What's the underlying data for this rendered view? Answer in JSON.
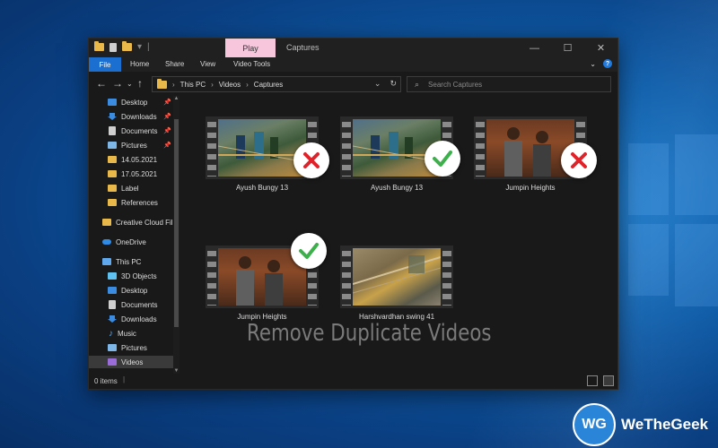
{
  "window": {
    "title": "Captures",
    "context_tab": "Play",
    "controls": [
      "—",
      "☐",
      "✕"
    ]
  },
  "ribbon": {
    "file": "File",
    "tabs": [
      "Home",
      "Share",
      "View",
      "Video Tools"
    ]
  },
  "address": {
    "root": "This PC",
    "crumbs": [
      "This PC",
      "Videos",
      "Captures"
    ],
    "search_placeholder": "Search Captures"
  },
  "nav": {
    "quick_access": [
      {
        "label": "Desktop",
        "icon": "desktop-icon",
        "pinned": true
      },
      {
        "label": "Downloads",
        "icon": "download-icon",
        "pinned": true
      },
      {
        "label": "Documents",
        "icon": "documents-icon",
        "pinned": true
      },
      {
        "label": "Pictures",
        "icon": "pictures-icon",
        "pinned": true
      },
      {
        "label": "14.05.2021",
        "icon": "folder-icon",
        "pinned": false
      },
      {
        "label": "17.05.2021",
        "icon": "folder-icon",
        "pinned": false
      },
      {
        "label": "Label",
        "icon": "folder-icon",
        "pinned": false
      },
      {
        "label": "References",
        "icon": "folder-icon",
        "pinned": false
      }
    ],
    "creative_cloud": "Creative Cloud Fil",
    "onedrive": "OneDrive",
    "this_pc": "This PC",
    "this_pc_items": [
      {
        "label": "3D Objects",
        "icon": "3d-objects-icon"
      },
      {
        "label": "Desktop",
        "icon": "desktop-icon"
      },
      {
        "label": "Documents",
        "icon": "documents-icon"
      },
      {
        "label": "Downloads",
        "icon": "download-icon"
      },
      {
        "label": "Music",
        "icon": "music-icon"
      },
      {
        "label": "Pictures",
        "icon": "pictures-icon"
      },
      {
        "label": "Videos",
        "icon": "videos-icon"
      }
    ]
  },
  "files": [
    {
      "name": "Ayush Bungy 13",
      "status": "duplicate"
    },
    {
      "name": "Ayush Bungy 13",
      "status": "keep"
    },
    {
      "name": "Jumpin Heights",
      "status": "duplicate"
    },
    {
      "name": "Jumpin Heights",
      "status": "keep"
    },
    {
      "name": "Harshvardhan swing 41",
      "status": "none"
    }
  ],
  "overlay_text": "Remove Duplicate Videos",
  "status": {
    "item_count": "0 items"
  },
  "brand": {
    "logo_letters": "WG",
    "name": "WeTheGeek"
  },
  "colors": {
    "accent": "#1a6fd0",
    "play_tab": "#f7c6dc",
    "check": "#3cb04a",
    "cross": "#e0232b"
  }
}
